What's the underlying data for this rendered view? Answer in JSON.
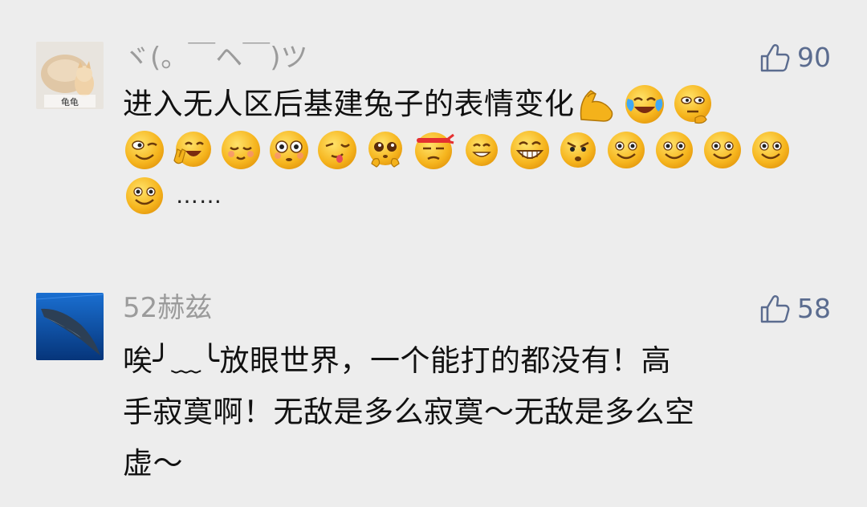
{
  "comments": [
    {
      "username": "ヾ(。￣ヘ￣)ツ",
      "avatar_label": "龟龟",
      "like_count": "90",
      "text": "进入无人区后基建兔子的表情变化",
      "trailing_text": "……",
      "emojis": [
        "muscle",
        "laughing-tears",
        "thinking",
        "squint",
        "peace-grin",
        "blush",
        "flushed",
        "wink-tongue",
        "pleading",
        "headband-tired",
        "grin-small",
        "big-grin",
        "angry",
        "smile",
        "smile",
        "smile",
        "smile",
        "smile"
      ]
    },
    {
      "username": "52赫兹",
      "like_count": "58",
      "text_line1": "唉╯﹏╰放眼世界，一个能打的都没有！高",
      "text_line2": "手寂寞啊！无敌是多么寂寞～无敌是多么空",
      "text_line3": "虚～"
    }
  ],
  "colors": {
    "background": "#ededed",
    "username": "#9b9b9b",
    "like": "#5b6c8f",
    "text": "#111111"
  }
}
